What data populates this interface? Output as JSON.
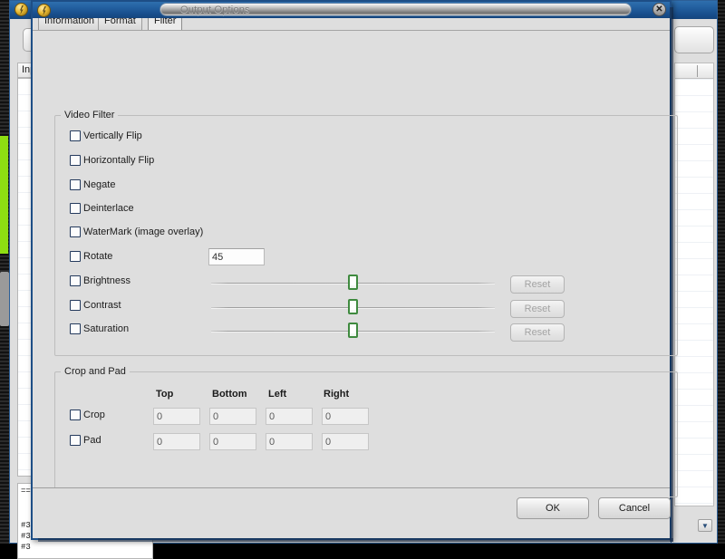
{
  "desktop": {
    "background_color": "#0c0c0c",
    "accent_strip_color": "#8ede12"
  },
  "main_window": {
    "title": "",
    "input_list_header": "Inp",
    "log_lines": [
      "==",
      "#3",
      "#3",
      "#3"
    ],
    "window_buttons": {
      "minimize": "–",
      "maximize": "▫",
      "close": "✕"
    }
  },
  "right_window": {
    "spinner_glyph": "▼"
  },
  "dialog": {
    "title": "Output Options",
    "close_label": "✕",
    "tabs": [
      {
        "label": "Information",
        "active": false
      },
      {
        "label": "Format",
        "active": false
      },
      {
        "label": "Filter",
        "active": true
      }
    ],
    "video_filter": {
      "legend": "Video Filter",
      "checkboxes": [
        {
          "label": "Vertically Flip",
          "checked": false
        },
        {
          "label": "Horizontally Flip",
          "checked": false
        },
        {
          "label": "Negate",
          "checked": false
        },
        {
          "label": "Deinterlace",
          "checked": false
        },
        {
          "label": "WaterMark (image overlay)",
          "checked": false
        }
      ],
      "rotate": {
        "label": "Rotate",
        "checked": false,
        "value": "45"
      },
      "sliders": [
        {
          "label": "Brightness",
          "checked": false,
          "value": 50,
          "reset_label": "Reset",
          "reset_enabled": false
        },
        {
          "label": "Contrast",
          "checked": false,
          "value": 50,
          "reset_label": "Reset",
          "reset_enabled": false
        },
        {
          "label": "Saturation",
          "checked": false,
          "value": 50,
          "reset_label": "Reset",
          "reset_enabled": false
        }
      ]
    },
    "crop_and_pad": {
      "legend": "Crop and Pad",
      "columns": [
        "Top",
        "Bottom",
        "Left",
        "Right"
      ],
      "rows": [
        {
          "label": "Crop",
          "checked": false,
          "values": [
            "0",
            "0",
            "0",
            "0"
          ]
        },
        {
          "label": "Pad",
          "checked": false,
          "values": [
            "0",
            "0",
            "0",
            "0"
          ]
        }
      ]
    },
    "buttons": {
      "ok": "OK",
      "cancel": "Cancel"
    }
  }
}
